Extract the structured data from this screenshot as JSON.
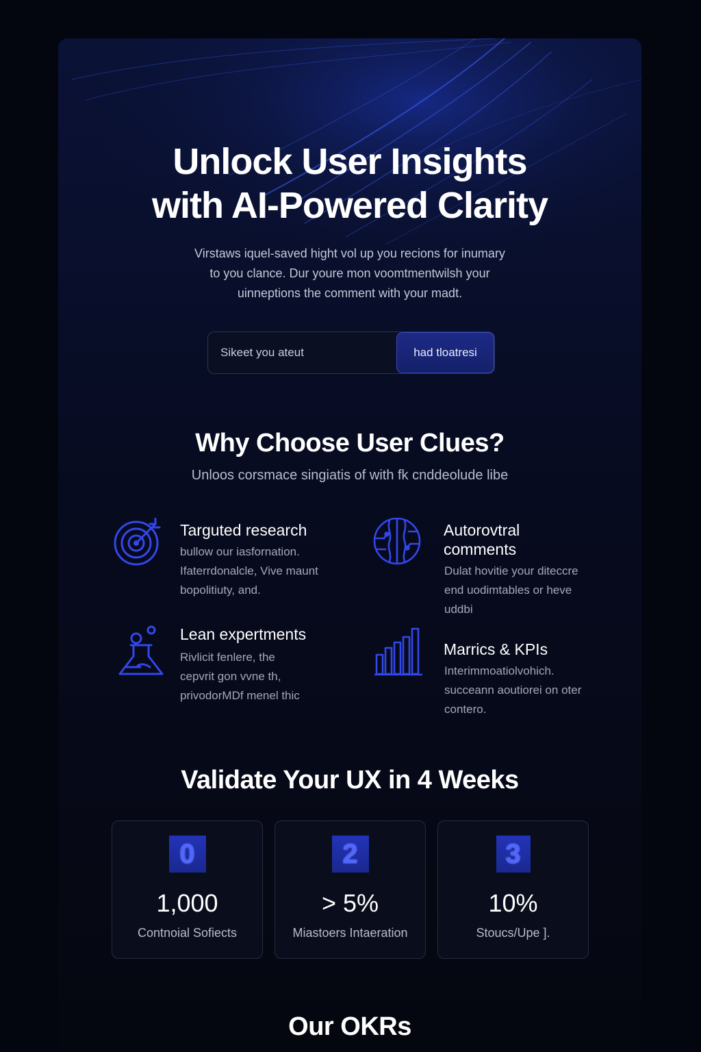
{
  "hero": {
    "title_line1": "Unlock User Insights",
    "title_line2": "with AI-Powered Clarity",
    "subtitle_line1": "Virstaws iquel-saved hight vol up you recions for inumary",
    "subtitle_line2": "to you clance. Dur youre mon voomtmentwilsh your",
    "subtitle_line3": "uinneptions the comment with your madt.",
    "input_placeholder": "Sikeet you ateut",
    "button_label": "had tloatresi"
  },
  "why": {
    "title": "Why Choose User Clues?",
    "subtitle": "Unloos corsmace singiatis of with  fk cnddeolude libe",
    "features": [
      {
        "icon": "target-icon",
        "title": "Targuted research",
        "desc_lines": [
          "bullow our iasfornation.",
          "Ifaterrdonalcle, Vive maunt",
          "bopolitiuty, and."
        ]
      },
      {
        "icon": "brain-circuit-icon",
        "title_lines": [
          "Autorovtral",
          "comments"
        ],
        "desc_lines": [
          "Dulat hovitie your diteccre",
          "end uodimtables or heve",
          "uddbi"
        ]
      },
      {
        "icon": "flask-icon",
        "title": "Lean expertments",
        "desc_lines": [
          "Rivlicit fenlere, the",
          "cepvrit gon vvne th,",
          "privodorMDf menel thic"
        ]
      },
      {
        "icon": "bar-chart-icon",
        "title": "Marrics & KPIs",
        "desc_lines": [
          "Interimmoatiolvohich.",
          "succeann aoutiorei on oter",
          "contero."
        ]
      }
    ]
  },
  "validate": {
    "title": "Validate Your UX in 4 Weeks",
    "stats": [
      {
        "badge": "0",
        "value": "1,000",
        "label": "Contnoial Sofiects"
      },
      {
        "badge": "2",
        "value": "> 5%",
        "label": "Miastoers Intaeration"
      },
      {
        "badge": "3",
        "value": "10%",
        "label": "Stoucs/Upe ]."
      }
    ]
  },
  "okrs": {
    "title": "Our OKRs"
  },
  "colors": {
    "accent": "#2f45e8",
    "icon_stroke": "#3347ea",
    "background": "#04060f"
  }
}
